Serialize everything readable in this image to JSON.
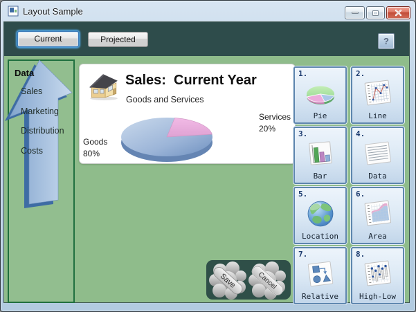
{
  "window": {
    "title": "Layout Sample"
  },
  "toolbar": {
    "current": "Current",
    "projected": "Projected",
    "help": "?"
  },
  "sidebar": {
    "header": "Data",
    "items": [
      "Sales",
      "Marketing",
      "Distribution",
      "Costs"
    ]
  },
  "card": {
    "title": "Sales:  Current Year",
    "subtitle": "Goods and Services",
    "goods_label": "Goods",
    "goods_value": "80%",
    "services_label": "Services",
    "services_value": "20%"
  },
  "chart_data": {
    "type": "pie",
    "title": "Sales: Current Year",
    "subtitle": "Goods and Services",
    "categories": [
      "Goods",
      "Services"
    ],
    "values": [
      80,
      20
    ],
    "unit": "percent",
    "style": "3d",
    "colors": [
      "#8FA9CE",
      "#E9AEDF"
    ],
    "legend_position": "labels-beside-pie"
  },
  "grid": {
    "items": [
      {
        "number": "1.",
        "label": "Pie"
      },
      {
        "number": "2.",
        "label": "Line"
      },
      {
        "number": "3.",
        "label": "Bar"
      },
      {
        "number": "4.",
        "label": "Data"
      },
      {
        "number": "5.",
        "label": "Location"
      },
      {
        "number": "6.",
        "label": "Area"
      },
      {
        "number": "7.",
        "label": "Relative"
      },
      {
        "number": "8.",
        "label": "High-Low"
      }
    ]
  },
  "actions": {
    "save_label": "Save",
    "cancel_label": "Cancel"
  },
  "colors": {
    "toolbar_bg": "#2E4C4B",
    "main_bg": "#8FBC8B",
    "sidebar_border": "#20703F",
    "panel_bg": "#2F4F48",
    "grid_button_border": "#5E86AE",
    "arrow_blue": "#9DBBDE",
    "focus_ring": "#4DA0DF",
    "titlebar": "#BAD0E4",
    "close_red": "#C14A36"
  }
}
